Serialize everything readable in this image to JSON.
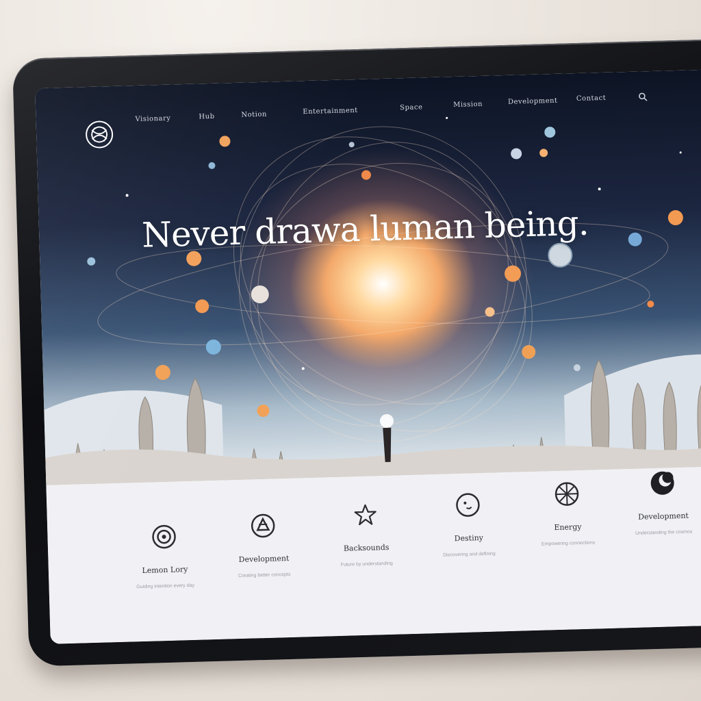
{
  "site": {
    "logo_icon": "knot-emblem-icon",
    "nav": [
      {
        "label": "Visionary"
      },
      {
        "label": "Hub"
      },
      {
        "label": "Notion"
      },
      {
        "label": "Entertainment"
      },
      {
        "label": "Space"
      },
      {
        "label": "Mission"
      },
      {
        "label": "Development"
      },
      {
        "label": "Contact"
      }
    ],
    "search_icon": "search-icon",
    "accent": "#f3a86a"
  },
  "hero": {
    "headline": "Never drawa luman being."
  },
  "features": [
    {
      "icon": "target-icon",
      "title": "Lemon Lory",
      "desc": "Guiding intention every day"
    },
    {
      "icon": "compass-emblem-icon",
      "title": "Development",
      "desc": "Creating better concepts"
    },
    {
      "icon": "star-icon",
      "title": "Backsounds",
      "desc": "Future by understanding"
    },
    {
      "icon": "face-circle-icon",
      "title": "Destiny",
      "desc": "Discovering and defining"
    },
    {
      "icon": "wheel-icon",
      "title": "Energy",
      "desc": "Empowering connections"
    },
    {
      "icon": "moon-icon",
      "title": "Development",
      "desc": "Understanding the cosmos"
    }
  ]
}
